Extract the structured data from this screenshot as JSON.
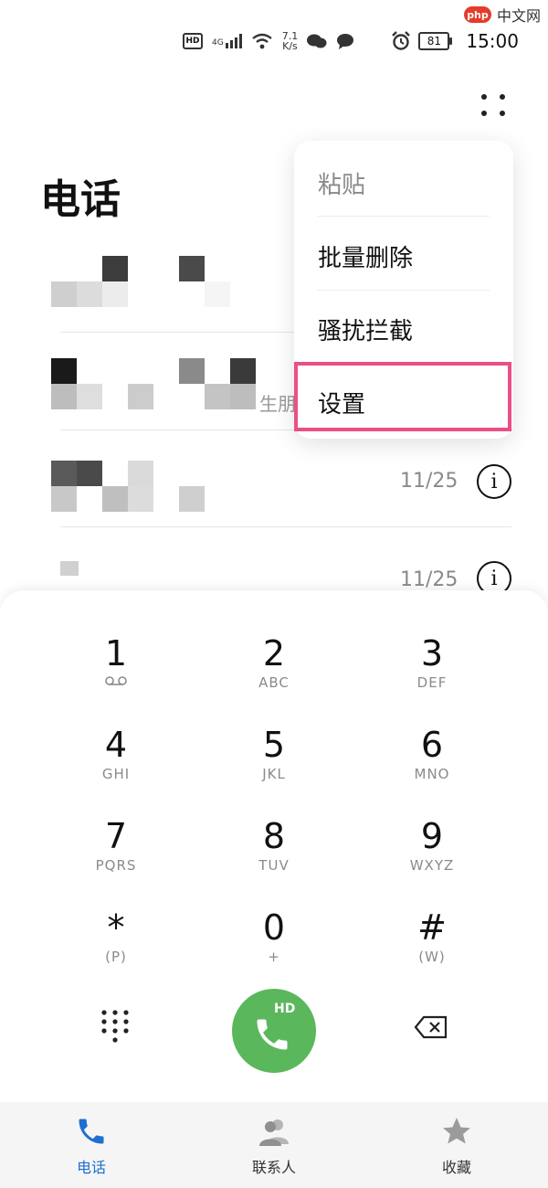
{
  "watermark": {
    "logo": "php",
    "text": "中文网"
  },
  "status_bar": {
    "hd": "HD",
    "network": "4G",
    "speed_value": "7.1",
    "speed_unit": "K/s",
    "battery": "81",
    "time": "15:00"
  },
  "header": {
    "title": "电话"
  },
  "calls": [
    {
      "visible_text": "",
      "date": ""
    },
    {
      "visible_text": "生朋",
      "date": ""
    },
    {
      "visible_text": "",
      "date": "11/25"
    },
    {
      "visible_text": "",
      "date": "11/25"
    }
  ],
  "menu": {
    "items": [
      "粘贴",
      "批量删除",
      "骚扰拦截",
      "设置"
    ],
    "highlighted": "设置"
  },
  "dialpad": {
    "keys": [
      {
        "digit": "1",
        "sub": ""
      },
      {
        "digit": "2",
        "sub": "ABC"
      },
      {
        "digit": "3",
        "sub": "DEF"
      },
      {
        "digit": "4",
        "sub": "GHI"
      },
      {
        "digit": "5",
        "sub": "JKL"
      },
      {
        "digit": "6",
        "sub": "MNO"
      },
      {
        "digit": "7",
        "sub": "PQRS"
      },
      {
        "digit": "8",
        "sub": "TUV"
      },
      {
        "digit": "9",
        "sub": "WXYZ"
      },
      {
        "digit": "*",
        "sub": "(P)"
      },
      {
        "digit": "0",
        "sub": "+"
      },
      {
        "digit": "#",
        "sub": "(W)"
      }
    ],
    "call_label": "HD"
  },
  "tabs": [
    {
      "label": "电话",
      "active": true,
      "color": "#1f6fd1"
    },
    {
      "label": "联系人",
      "active": false,
      "color": "#333333"
    },
    {
      "label": "收藏",
      "active": false,
      "color": "#333333"
    }
  ],
  "colors": {
    "accent": "#1f6fd1",
    "call_green": "#5bb75b",
    "highlight": "#ea4f87"
  }
}
